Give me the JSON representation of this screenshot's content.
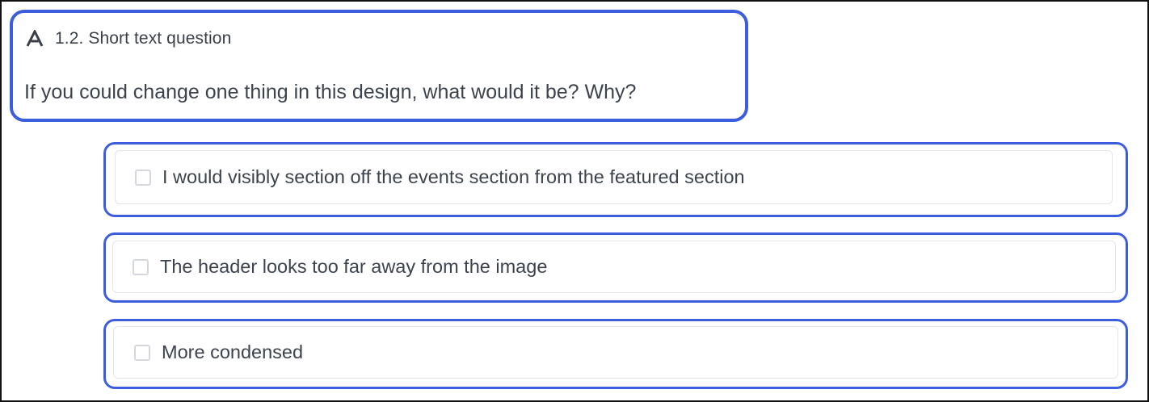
{
  "question": {
    "type_icon": "short-text-icon",
    "label": "1.2. Short text question",
    "text": "If you could change one thing in this design, what would it be? Why?"
  },
  "answers": [
    {
      "text": "I would visibly section off the events section from the featured section",
      "checked": false
    },
    {
      "text": "The header looks too far away from the image",
      "checked": false
    },
    {
      "text": "More condensed",
      "checked": false
    }
  ],
  "colors": {
    "highlight_border": "#3d5ddf",
    "text": "#3d434d",
    "checkbox_border": "#d4d7dd"
  }
}
